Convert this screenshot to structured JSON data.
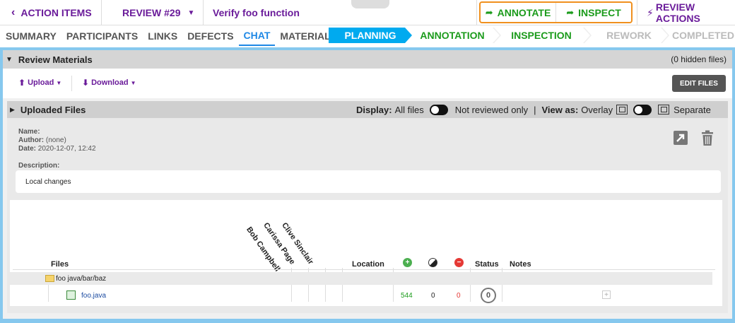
{
  "topbar": {
    "back_label": "ACTION ITEMS",
    "review_label": "REVIEW #29",
    "review_title": "Verify foo function",
    "annotate_label": "ANNOTATE",
    "inspect_label": "INSPECT",
    "review_actions_label": "REVIEW ACTIONS"
  },
  "tabs": [
    {
      "label": "SUMMARY"
    },
    {
      "label": "PARTICIPANTS"
    },
    {
      "label": "LINKS"
    },
    {
      "label": "DEFECTS"
    },
    {
      "label": "CHAT"
    },
    {
      "label": "MATERIALS"
    }
  ],
  "workflow": {
    "planning": "PLANNING",
    "annotation": "ANNOTATION",
    "inspection": "INSPECTION",
    "rework": "REWORK",
    "completed": "COMPLETED"
  },
  "materials": {
    "title": "Review Materials",
    "hidden_files": "(0 hidden files)",
    "upload_label": "Upload",
    "download_label": "Download",
    "edit_files_label": "EDIT FILES"
  },
  "uploaded": {
    "title": "Uploaded Files",
    "display_label": "Display:",
    "display_all": "All files",
    "display_not_reviewed": "Not reviewed only",
    "view_sep": "|",
    "view_label": "View as:",
    "view_overlay": "Overlay",
    "view_separate": "Separate"
  },
  "meta": {
    "name_label": "Name:",
    "name_value": "",
    "author_label": "Author:",
    "author_value": "(none)",
    "date_label": "Date:",
    "date_value": "2020-12-07, 12:42",
    "description_label": "Description:",
    "description_value": "Local changes"
  },
  "table": {
    "files_header": "Files",
    "participants": [
      "Bob Campbell",
      "Carissa Page",
      "Clive Sinclair"
    ],
    "location_header": "Location",
    "status_header": "Status",
    "notes_header": "Notes",
    "folder": "foo java/bar/baz",
    "file_name": "foo.java",
    "added": "544",
    "modified": "0",
    "removed": "0",
    "status_value": "0"
  },
  "colors": {
    "accent_purple": "#6a1b9a",
    "accent_blue": "#1e88e5",
    "green": "#1b9b1b",
    "orange": "#f0901e",
    "panel_blue": "#86c8ee"
  }
}
